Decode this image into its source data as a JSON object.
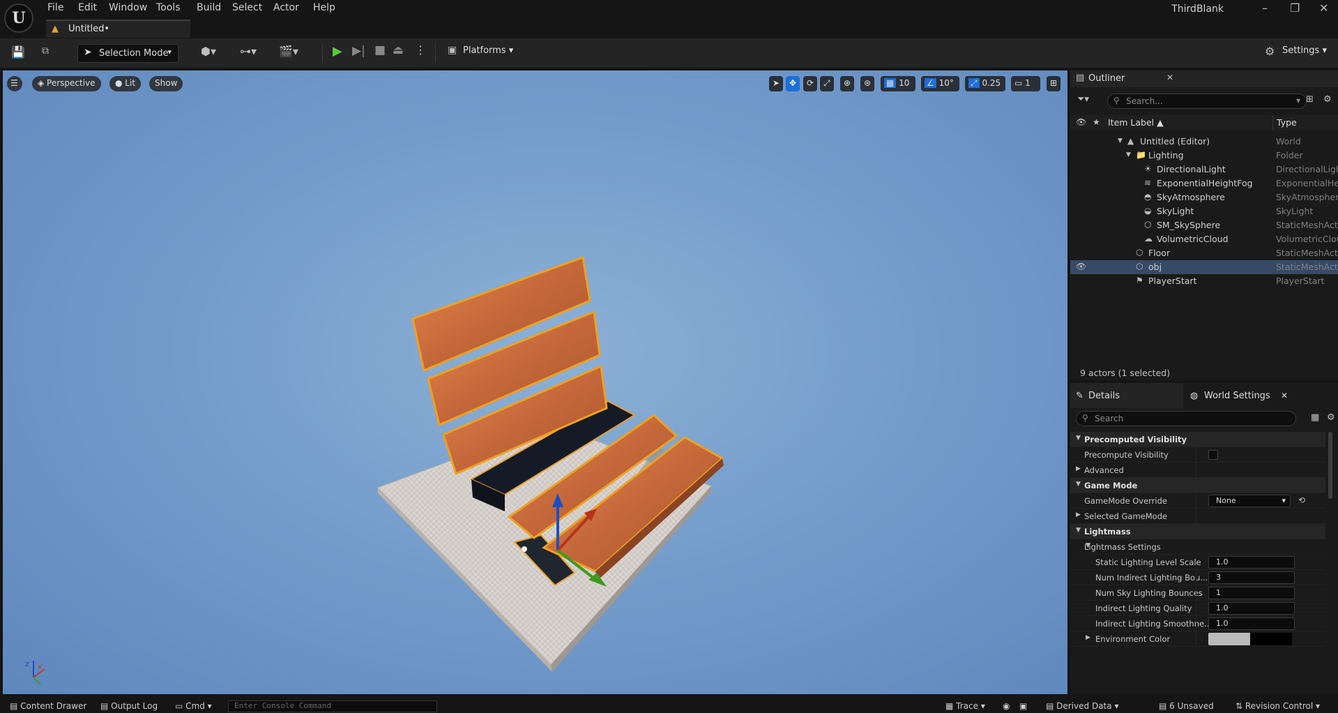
{
  "menu": {
    "items": [
      "File",
      "Edit",
      "Window",
      "Tools",
      "Build",
      "Select",
      "Actor",
      "Help"
    ],
    "app_name": "ThirdBlank"
  },
  "tab": {
    "label": "Untitled•"
  },
  "toolbar": {
    "selection_mode": "Selection Mode",
    "platforms": "Platforms",
    "settings": "Settings"
  },
  "viewport": {
    "perspective": "Perspective",
    "lit": "Lit",
    "show": "Show",
    "grid_snap": "10",
    "rotate_snap": "10°",
    "scale_snap": "0.25",
    "camera_speed": "1",
    "axis_x": "x",
    "axis_z": "z"
  },
  "outliner": {
    "title": "Outliner",
    "search_placeholder": "Search...",
    "col_label": "Item Label ▲",
    "col_type": "Type",
    "rows": [
      {
        "label": "Untitled (Editor)",
        "type": "World",
        "icon": "world-icon"
      },
      {
        "label": "Lighting",
        "type": "Folder",
        "icon": "folder-icon"
      },
      {
        "label": "DirectionalLight",
        "type": "DirectionalLight",
        "icon": "sun-icon"
      },
      {
        "label": "ExponentialHeightFog",
        "type": "ExponentialHeightFog",
        "icon": "fog-icon"
      },
      {
        "label": "SkyAtmosphere",
        "type": "SkyAtmosphere",
        "icon": "atmosphere-icon"
      },
      {
        "label": "SkyLight",
        "type": "SkyLight",
        "icon": "skylight-icon"
      },
      {
        "label": "SM_SkySphere",
        "type": "StaticMeshActor",
        "icon": "mesh-icon"
      },
      {
        "label": "VolumetricCloud",
        "type": "VolumetricCloud",
        "icon": "cloud-icon"
      },
      {
        "label": "Floor",
        "type": "StaticMeshActor",
        "icon": "mesh-icon"
      },
      {
        "label": "obj",
        "type": "StaticMeshActor",
        "icon": "mesh-icon"
      },
      {
        "label": "PlayerStart",
        "type": "PlayerStart",
        "icon": "player-start-icon"
      }
    ],
    "actor_count": "9 actors (1 selected)"
  },
  "details": {
    "tab_details": "Details",
    "tab_world_settings": "World Settings",
    "search_placeholder": "Search",
    "rows": [
      {
        "kind": "cat",
        "label": "Precomputed Visibility"
      },
      {
        "kind": "prop",
        "label": "Precompute Visibility",
        "control": "checkbox"
      },
      {
        "kind": "sub",
        "label": "Advanced"
      },
      {
        "kind": "cat",
        "label": "Game Mode"
      },
      {
        "kind": "prop",
        "label": "GameMode Override",
        "control": "dropdown",
        "value": "None"
      },
      {
        "kind": "sub",
        "label": "Selected GameMode"
      },
      {
        "kind": "cat",
        "label": "Lightmass"
      },
      {
        "kind": "cat2",
        "label": "Lightmass Settings"
      },
      {
        "kind": "prop2",
        "label": "Static Lighting Level Scale",
        "value": "1.0"
      },
      {
        "kind": "prop2",
        "label": "Num Indirect Lighting Bou...",
        "value": "3"
      },
      {
        "kind": "prop2",
        "label": "Num Sky Lighting Bounces",
        "value": "1"
      },
      {
        "kind": "prop2",
        "label": "Indirect Lighting Quality",
        "value": "1.0"
      },
      {
        "kind": "prop2",
        "label": "Indirect Lighting Smoothne...",
        "value": "1.0"
      },
      {
        "kind": "sub2",
        "label": "Environment Color",
        "control": "color"
      }
    ]
  },
  "statusbar": {
    "content_drawer": "Content Drawer",
    "output_log": "Output Log",
    "cmd": "Cmd",
    "console_placeholder": "Enter Console Command",
    "trace": "Trace",
    "derived_data": "Derived Data",
    "unsaved": "6 Unsaved",
    "revision_control": "Revision Control"
  }
}
